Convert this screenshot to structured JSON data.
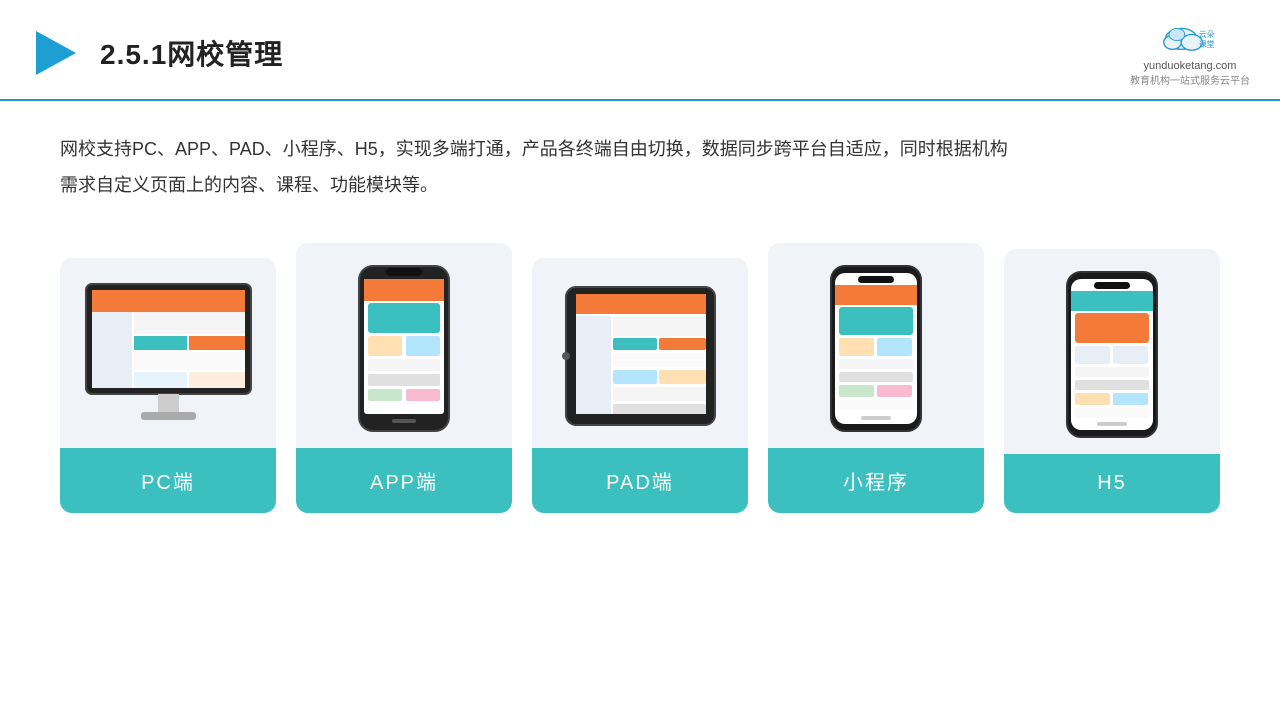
{
  "header": {
    "title": "2.5.1网校管理",
    "logo_name": "云朵课堂",
    "logo_domain": "yunduoketang.com",
    "logo_tagline": "教育机构一站式服务云平台"
  },
  "description": {
    "text1": "网校支持PC、APP、PAD、小程序、H5，实现多端打通，产品各终端自由切换，数据同步跨平台自适应，同时根据机构",
    "text2": "需求自定义页面上的内容、课程、功能模块等。"
  },
  "cards": [
    {
      "id": "pc",
      "label": "PC端"
    },
    {
      "id": "app",
      "label": "APP端"
    },
    {
      "id": "pad",
      "label": "PAD端"
    },
    {
      "id": "miniprogram",
      "label": "小程序"
    },
    {
      "id": "h5",
      "label": "H5"
    }
  ],
  "accent_color": "#3bbfbf",
  "border_color": "#2196d3"
}
